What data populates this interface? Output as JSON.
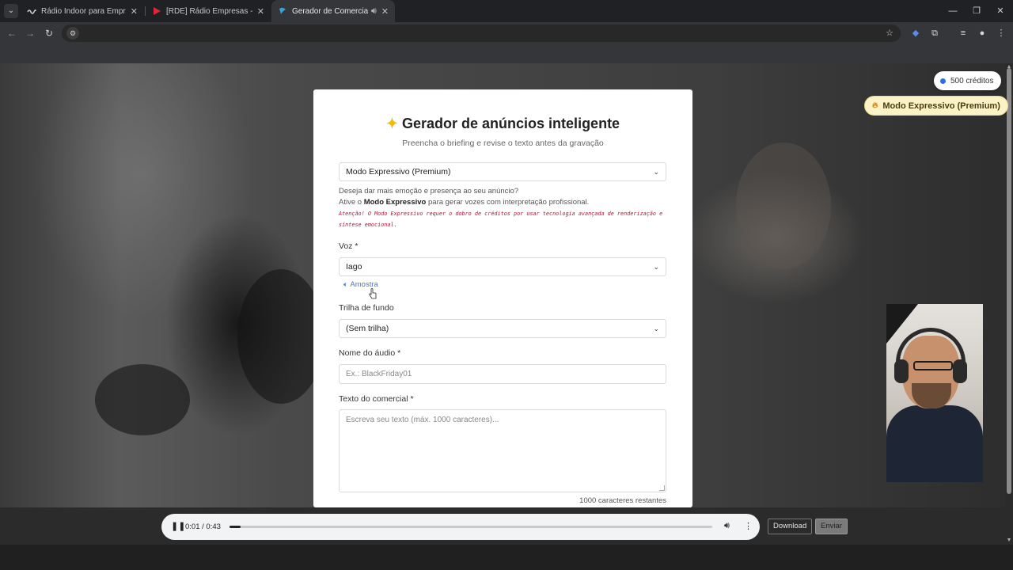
{
  "browser": {
    "tabs": [
      {
        "title": "Rádio Indoor para Empresas | R",
        "active": false
      },
      {
        "title": "[RDE] Rádio Empresas - Player",
        "active": false
      },
      {
        "title": "Gerador de Comerciais de",
        "active": true
      }
    ],
    "colors": {
      "tab_bar": "#202124",
      "toolbar": "#35363a"
    }
  },
  "badges": {
    "credits": "500 créditos",
    "premium": "Modo Expressivo (Premium)"
  },
  "form": {
    "title": "Gerador de anúncios inteligente",
    "subtitle": "Preencha o briefing e revise o texto antes da gravação",
    "mode_select": {
      "value": "Modo Expressivo (Premium)"
    },
    "mode_help": {
      "line1": "Deseja dar mais emoção e presença ao seu anúncio?",
      "line2_prefix": "Ative o ",
      "line2_bold": "Modo Expressivo",
      "line2_suffix": " para gerar vozes com interpretação profissional.",
      "warning": "Atenção! O Modo Expressivo requer o dobro de créditos por usar tecnologia avançada de renderização e síntese emocional."
    },
    "voice": {
      "label": "Voz *",
      "value": "Iago",
      "sample_link": "Amostra"
    },
    "track": {
      "label": "Trilha de fundo",
      "value": "(Sem trilha)"
    },
    "audio_name": {
      "label": "Nome do áudio *",
      "placeholder": "Ex.: BlackFriday01"
    },
    "ad_text": {
      "label": "Texto do comercial *",
      "placeholder": "Escreva seu texto (máx. 1000 caracteres)...",
      "counter": "1000 caracteres restantes"
    }
  },
  "player": {
    "time": "0:01 / 0:43",
    "progress_fraction": 0.023,
    "download_label": "Download",
    "send_label": "Enviar"
  },
  "colors": {
    "accent_blue": "#2f6fe0",
    "premium_bg": "#fbf3c7",
    "warning_text": "#b3163a",
    "link": "#4a78c2"
  }
}
